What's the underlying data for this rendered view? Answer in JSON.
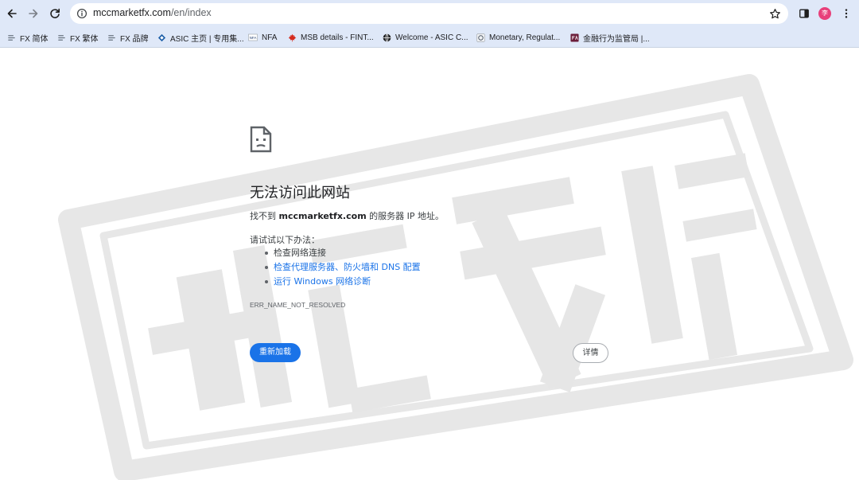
{
  "browser": {
    "url_host": "mccmarketfx.com",
    "url_path": "/en/index",
    "profile_initial": "李"
  },
  "bookmarks": [
    {
      "label": "FX 简体",
      "icon": "fx-icon"
    },
    {
      "label": "FX 繁体",
      "icon": "fx-icon"
    },
    {
      "label": "FX 品牌",
      "icon": "fx-icon"
    },
    {
      "label": "ASIC 主页 | 专用集...",
      "icon": "asic-icon"
    },
    {
      "label": "NFA",
      "icon": "nfa-icon"
    },
    {
      "label": "MSB details - FINT...",
      "icon": "maple-leaf-icon"
    },
    {
      "label": "Welcome - ASIC C...",
      "icon": "globe-icon"
    },
    {
      "label": "Monetary, Regulat...",
      "icon": "mas-icon"
    },
    {
      "label": "金融行为监管局 |...",
      "icon": "fca-icon"
    }
  ],
  "error_page": {
    "title": "无法访问此网站",
    "desc_prefix": "找不到 ",
    "desc_domain": "mccmarketfx.com",
    "desc_suffix": " 的服务器 IP 地址。",
    "try_label": "请试试以下办法：",
    "suggestions": [
      "检查网络连接",
      "检查代理服务器、防火墙和 DNS 配置",
      "运行 Windows 网络诊断"
    ],
    "error_code": "ERR_NAME_NOT_RESOLVED",
    "reload_label": "重新加载",
    "details_label": "详情"
  },
  "colors": {
    "toolbar": "#dfe8f8",
    "accent": "#1a73e8",
    "watermark": "#e4e4e4"
  }
}
